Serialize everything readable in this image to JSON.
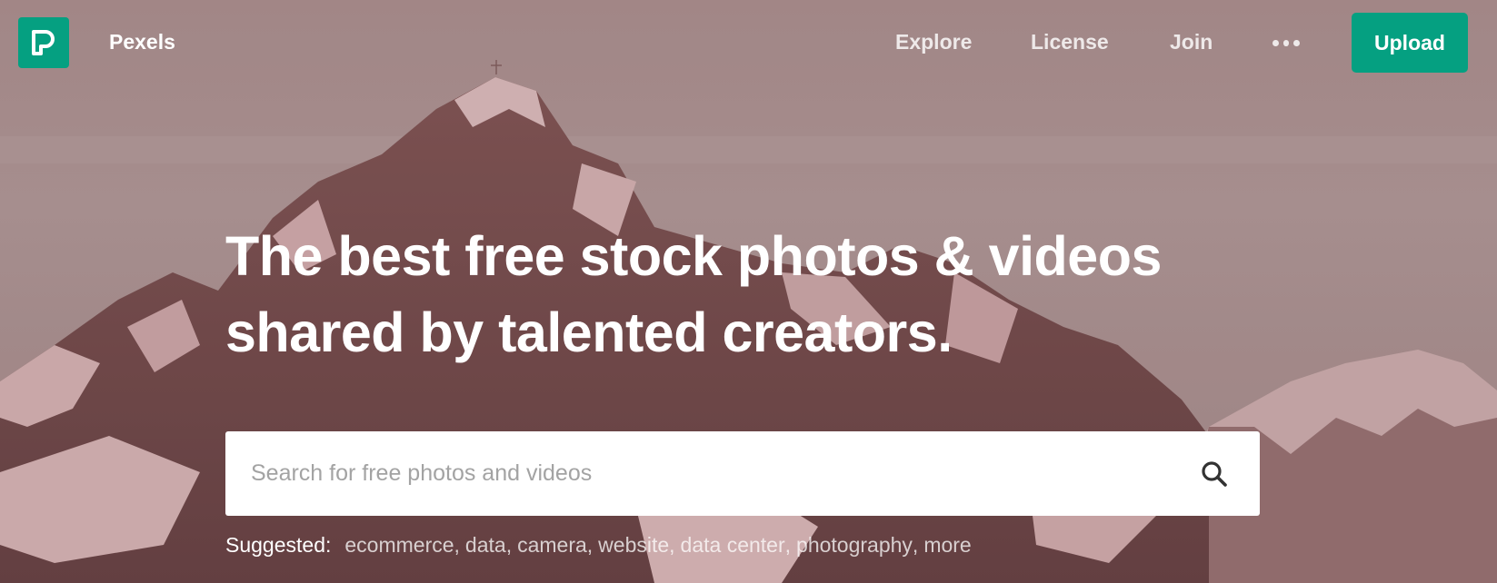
{
  "colors": {
    "accent": "#05a081",
    "overlay": "#a98c8c",
    "text_on_hero": "#ffffff"
  },
  "header": {
    "brand": "Pexels",
    "logo_icon": "pexels-logo-icon",
    "nav": [
      {
        "label": "Explore"
      },
      {
        "label": "License"
      },
      {
        "label": "Join"
      }
    ],
    "more_icon": "more-dots-icon",
    "upload_label": "Upload"
  },
  "hero": {
    "headline_line1": "The best free stock photos & videos",
    "headline_line2": "shared by talented creators.",
    "background": "mountain-photo"
  },
  "search": {
    "placeholder": "Search for free photos and videos",
    "value": "",
    "icon": "search-icon"
  },
  "suggested": {
    "label": "Suggested:",
    "items": [
      {
        "label": "ecommerce"
      },
      {
        "label": "data"
      },
      {
        "label": "camera"
      },
      {
        "label": "website"
      },
      {
        "label": "data center"
      },
      {
        "label": "photography"
      },
      {
        "label": "more"
      }
    ]
  }
}
